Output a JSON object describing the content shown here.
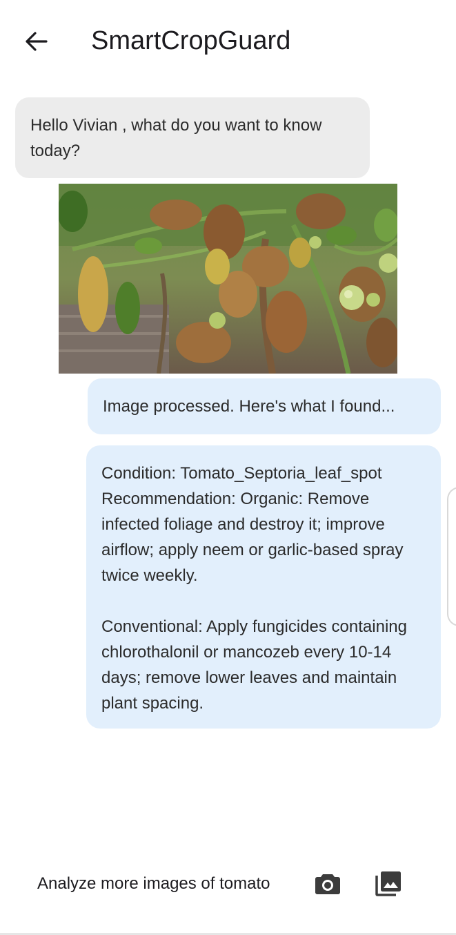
{
  "app": {
    "title": "SmartCropGuard",
    "back_icon": "arrow-back-icon"
  },
  "chat": {
    "greeting": "Hello Vivian , what do you want to know today?",
    "uploaded_image": {
      "subject": "tomato plant with wilted, yellowing leaves and green tomatoes"
    },
    "processed_message": "Image processed. Here's what I found...",
    "result_message": "Condition: Tomato_Septoria_leaf_spot\nRecommendation: Organic: Remove infected foliage and destroy it; improve airflow; apply neem or garlic-based spray twice weekly.\n\nConventional: Apply fungicides containing chlorothalonil or mancozeb every 10-14 days; remove lower leaves and maintain plant spacing."
  },
  "bottom_bar": {
    "label": "Analyze more images of tomato",
    "camera_icon": "camera-icon",
    "gallery_icon": "photo-library-icon"
  },
  "colors": {
    "greeting_bubble": "#ececec",
    "bot_bubble": "#e2effc",
    "icon_dark": "#3c3c3c"
  }
}
